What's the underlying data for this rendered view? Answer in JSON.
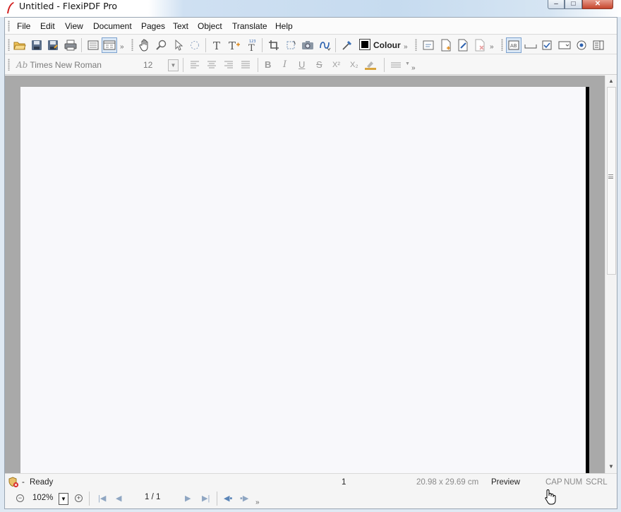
{
  "window": {
    "title": "Untitled - FlexiPDF Pro",
    "minimize_glyph": "–",
    "maximize_glyph": "□",
    "close_glyph": "✕"
  },
  "menu": {
    "items": [
      "File",
      "Edit",
      "View",
      "Document",
      "Pages",
      "Text",
      "Object",
      "Translate",
      "Help"
    ]
  },
  "toolbar": {
    "colour_label": "Colour",
    "colour_value": "#000000",
    "overflow_glyph": "»",
    "icons": [
      "open-folder-icon",
      "save-icon",
      "save-as-icon",
      "print-icon",
      "single-page-view-icon",
      "two-page-view-icon",
      "hand-tool-icon",
      "zoom-tool-icon",
      "select-arrow-icon",
      "lasso-select-icon",
      "text-tool-icon",
      "text-add-icon",
      "text-numbering-icon",
      "crop-icon",
      "rotate-object-icon",
      "snapshot-icon",
      "path-tool-icon",
      "eyedropper-icon",
      "page-annotation-icon",
      "insert-page-icon",
      "edit-page-icon",
      "delete-page-icon",
      "form-field-icon",
      "underline-field-icon",
      "checkbox-field-icon",
      "combo-field-icon",
      "radio-field-icon",
      "list-field-icon"
    ]
  },
  "format_bar": {
    "font_name": "Times New Roman",
    "font_prefix": "Ab",
    "font_size": "12",
    "bold": "B",
    "italic": "I",
    "underline": "U",
    "strike": "S",
    "superscript": "X²",
    "subscript": "X₂",
    "overflow_glyph": "»"
  },
  "status": {
    "state_dash": "-",
    "state": "Ready",
    "page_indicator": "1",
    "page_size": "20.98 x 29.69 cm",
    "mode": "Preview",
    "cap": "CAP",
    "num": "NUM",
    "scrl": "SCRL"
  },
  "navigation": {
    "zoom": "102%",
    "page": "1 / 1",
    "overflow_glyph": "»"
  }
}
